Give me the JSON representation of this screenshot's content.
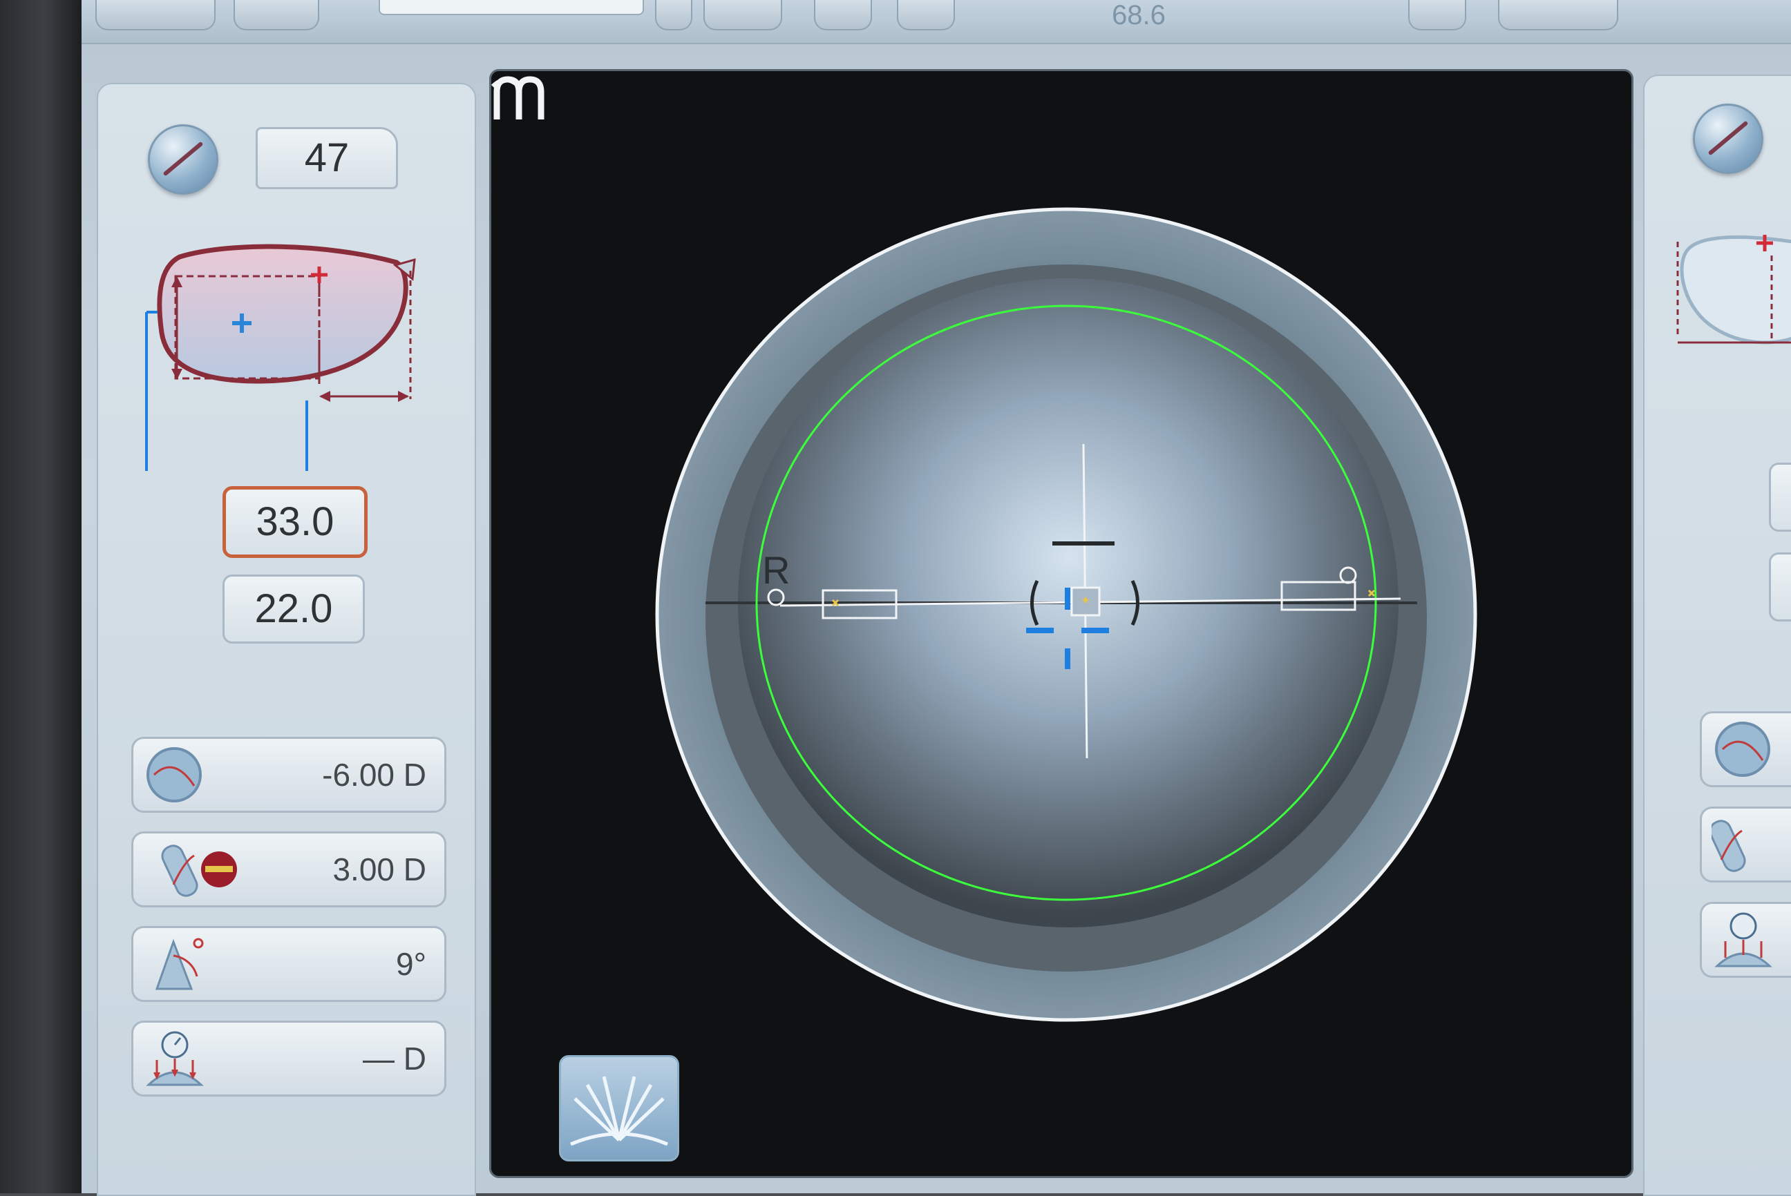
{
  "toolbar": {
    "readout": "68.6"
  },
  "left_panel": {
    "diameter_icon": "diameter-icon",
    "diameter_value": "47",
    "frame_icon": "frame-shape-icon",
    "height_value": "33.0",
    "offset_value": "22.0",
    "params": [
      {
        "icon": "sphere-icon",
        "value": "-6.00 D"
      },
      {
        "icon": "cylinder-icon",
        "value": "3.00 D"
      },
      {
        "icon": "axis-angle-icon",
        "value": "9°"
      },
      {
        "icon": "addition-gauge-icon",
        "value": "— D"
      }
    ]
  },
  "viewer": {
    "side_label": "R",
    "logo_icon": "brand-logo-icon",
    "book_icon": "book-icon"
  },
  "colors": {
    "accent_orange": "#c7623d",
    "frame_red": "#8a2d3a",
    "guide_green": "#3cff3c",
    "center_blue": "#1e7fe0"
  }
}
